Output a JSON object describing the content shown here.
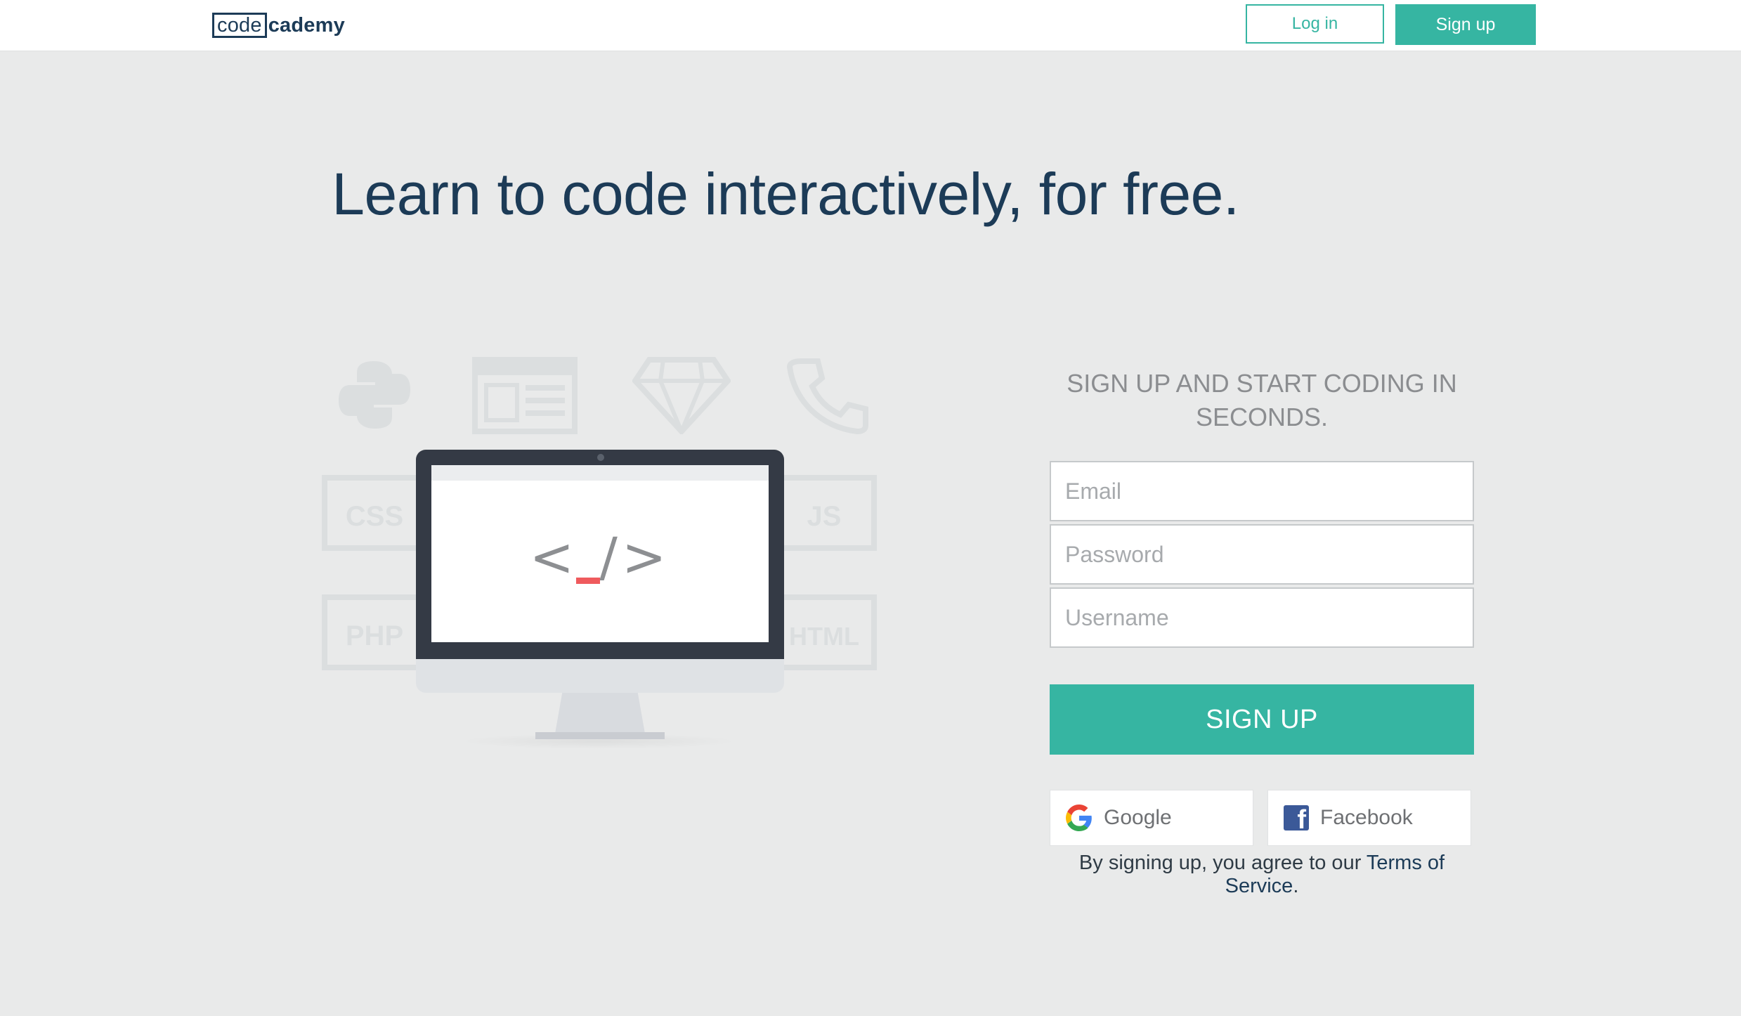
{
  "header": {
    "logo_box": "code",
    "logo_rest": "cademy",
    "login_label": "Log in",
    "signup_label": "Sign up"
  },
  "hero": {
    "title": "Learn to code interactively, for free."
  },
  "illustration": {
    "screen_code": "< /> ",
    "faded_labels": [
      "CSS",
      "JS",
      "PHP",
      "HTML"
    ]
  },
  "signup_form": {
    "heading": "SIGN UP AND START CODING IN SECONDS.",
    "email_placeholder": "Email",
    "password_placeholder": "Password",
    "username_placeholder": "Username",
    "submit_label": "SIGN UP",
    "google_label": "Google",
    "facebook_label": "Facebook",
    "terms_prefix": "By signing up, you agree to our ",
    "terms_link": "Terms of Service",
    "terms_suffix": "."
  },
  "colors": {
    "accent": "#36b5a2",
    "brand_navy": "#1c3b57",
    "background": "#e9eaea",
    "cursor_red": "#ef5a5d"
  }
}
